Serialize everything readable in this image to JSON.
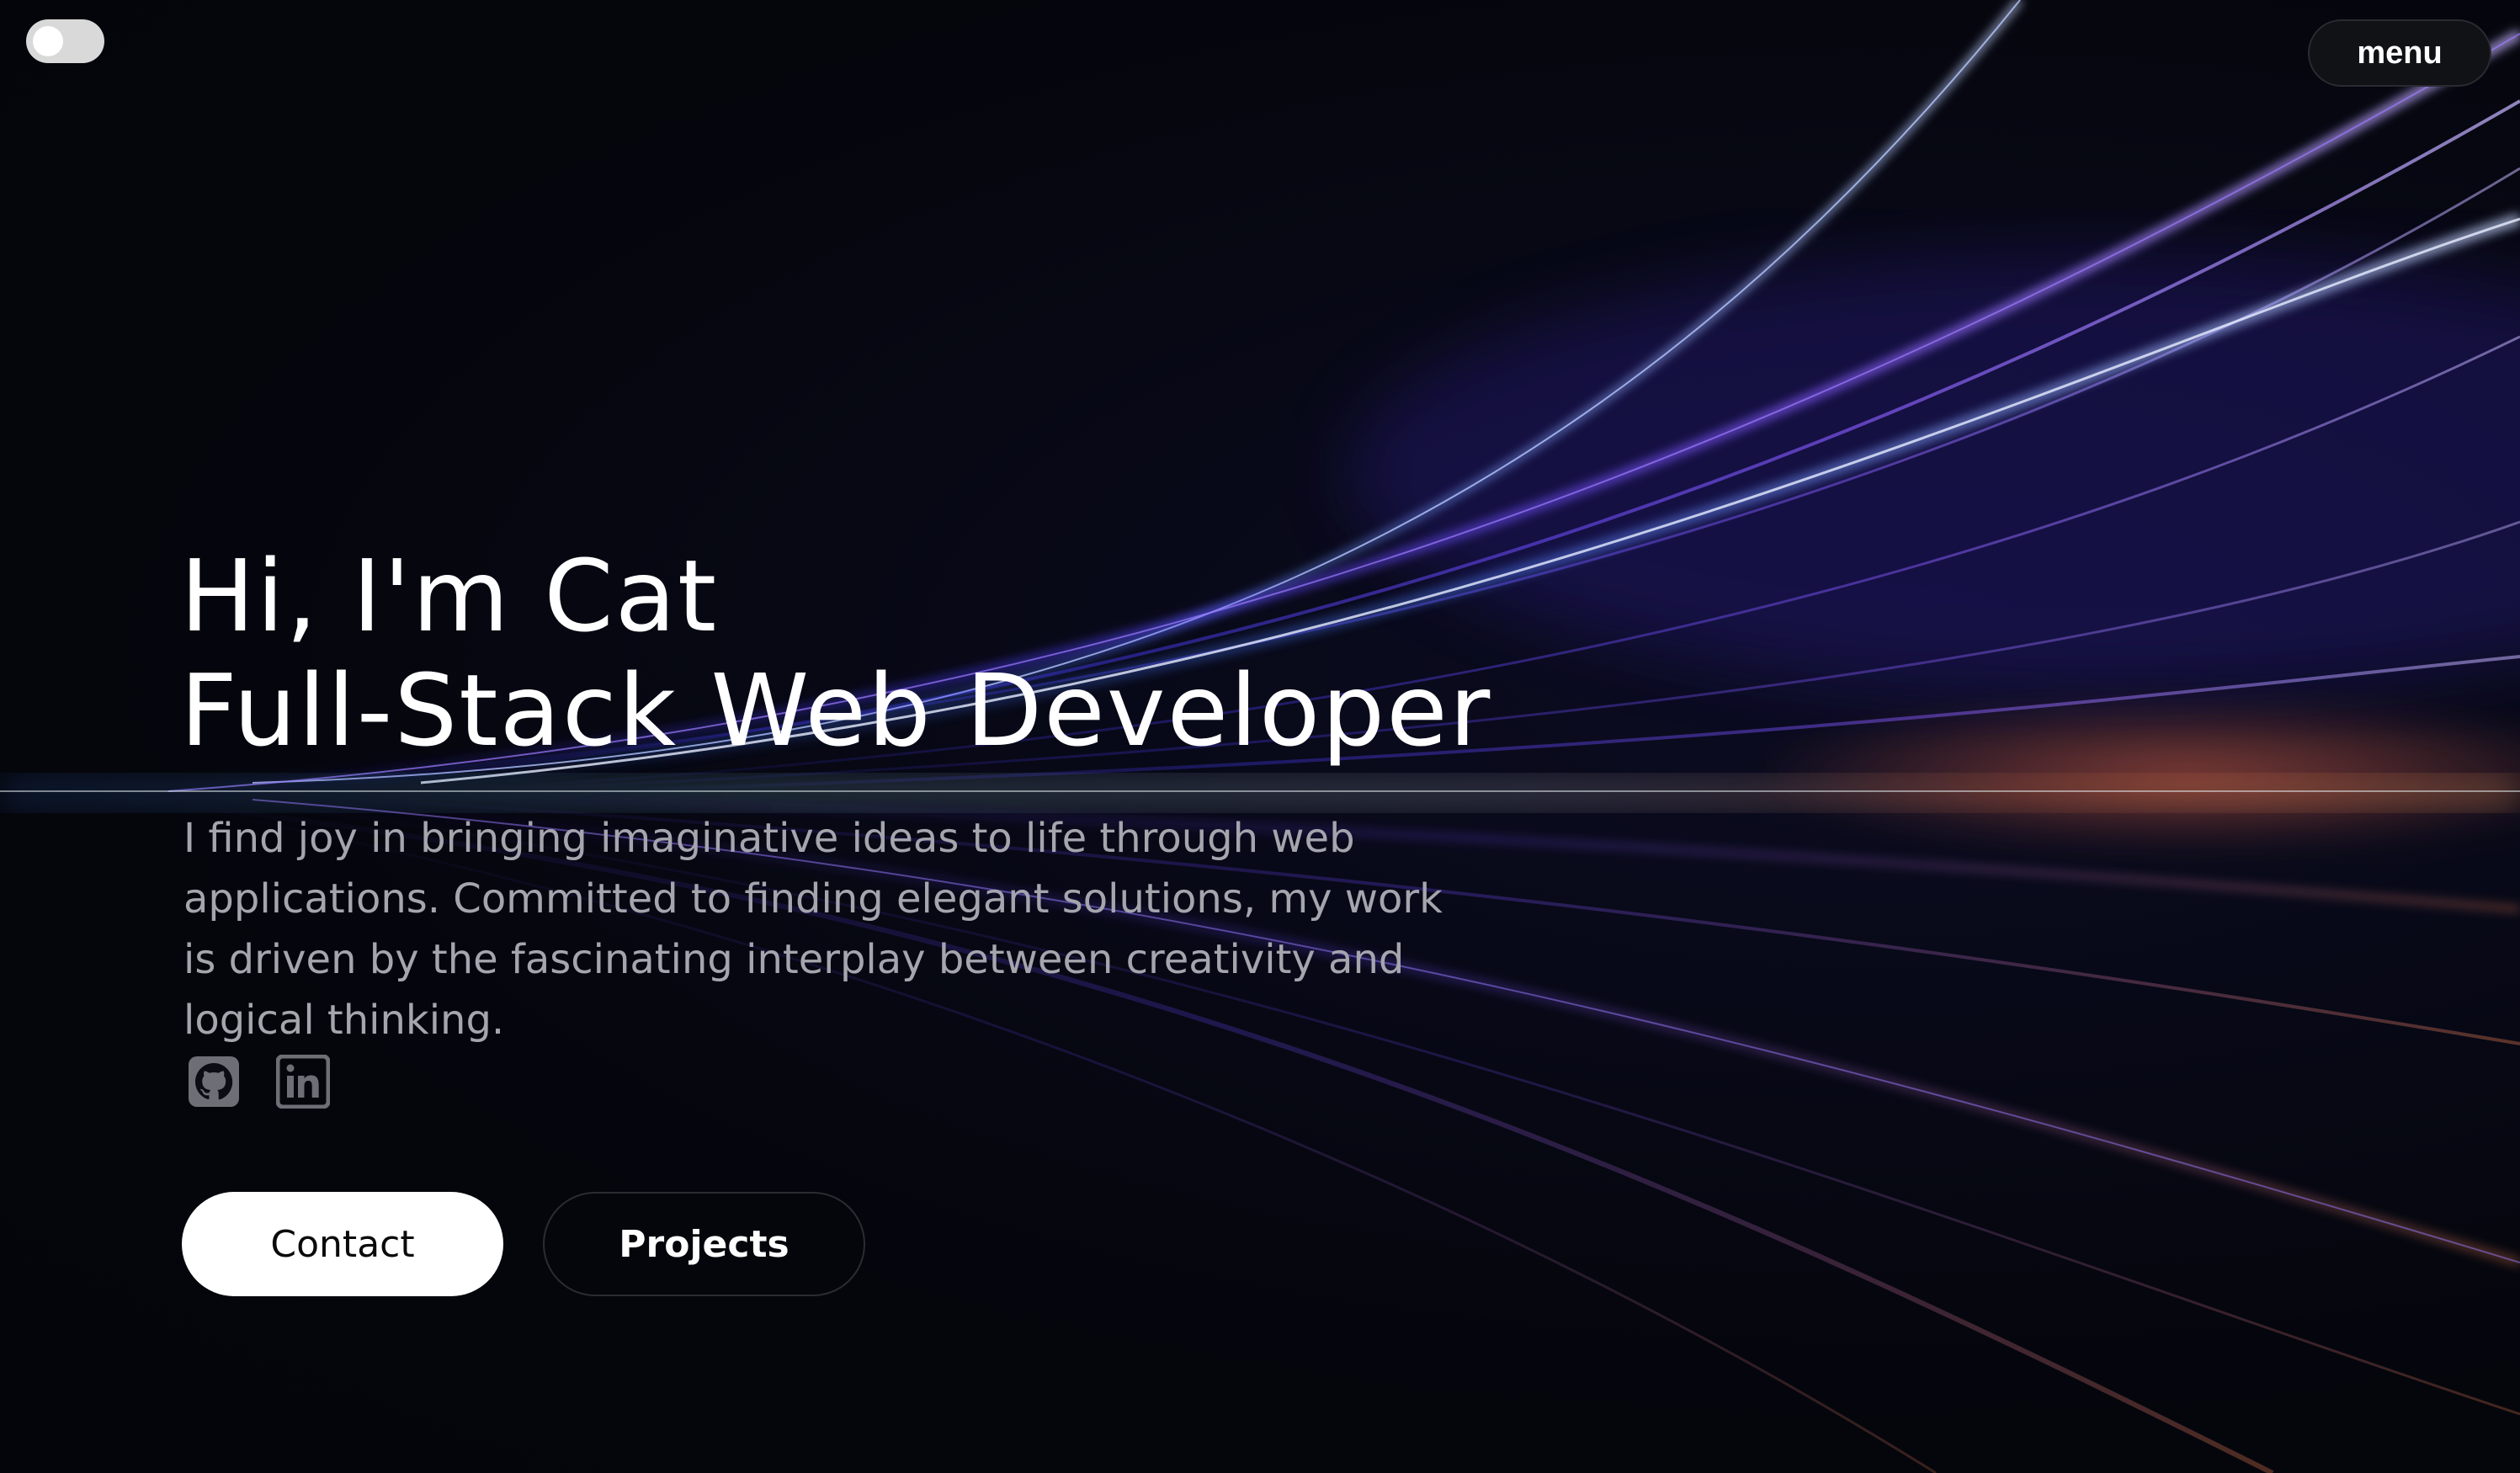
{
  "theme_toggle": {
    "state": "off"
  },
  "menu": {
    "label": "menu"
  },
  "hero": {
    "line1": "Hi, I'm Cat",
    "line2": "Full-Stack Web Developer",
    "description": "I find joy in bringing imaginative ideas to life through web applications. Committed to finding elegant solutions, my work is driven by the fascinating interplay between creativity and logical thinking."
  },
  "socials": [
    {
      "icon": "github-icon"
    },
    {
      "icon": "linkedin-icon"
    }
  ],
  "buttons": {
    "contact_label": "Contact",
    "projects_label": "Projects"
  },
  "colors": {
    "background": "#06070f",
    "text_primary": "#ffffff",
    "text_secondary": "#a4a5ad",
    "accent_purple": "#6b4cff",
    "accent_orange": "#e06a3a"
  }
}
